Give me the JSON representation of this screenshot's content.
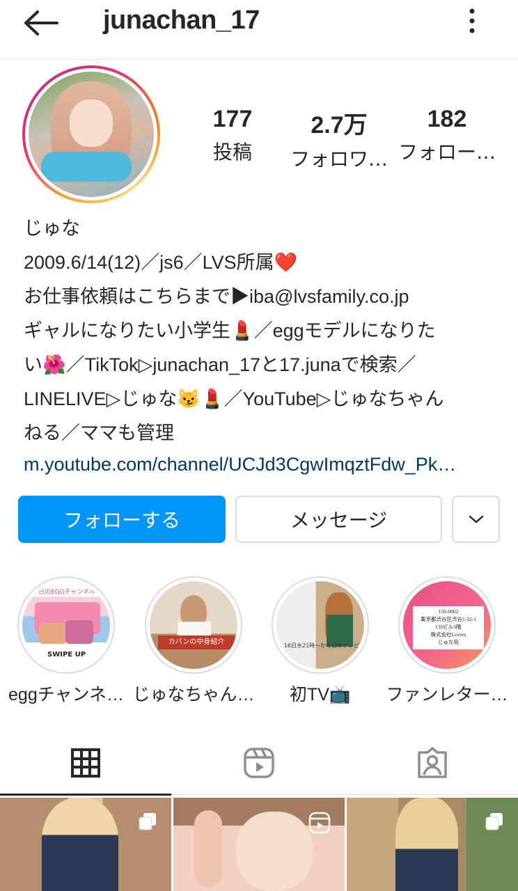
{
  "header": {
    "username": "junachan_17"
  },
  "stats": [
    {
      "value": "177",
      "label": "投稿"
    },
    {
      "value": "2.7万",
      "label": "フォロワ…"
    },
    {
      "value": "182",
      "label": "フォロー…"
    }
  ],
  "bio": {
    "name": "じゅな",
    "lines": [
      "2009.6/14(12)／js6／LVS所属❤️",
      "お仕事依頼はこちらまで▶iba@lvsfamily.co.jp",
      "ギャルになりたい小学生💄／eggモデルになりた",
      "い🌺／TikTok▷junachan_17と17.junaで検索／",
      "LINELIVE▷じゅな😼💄／YouTube▷じゅなちゃん",
      "ねる／ママも管理"
    ],
    "link": "m.youtube.com/channel/UCJd3CgwImqztFdw_Pk…"
  },
  "actions": {
    "follow": "フォローする",
    "message": "メッセージ"
  },
  "highlights": [
    {
      "label": "eggチャンネ…"
    },
    {
      "label": "じゅなちゃん…"
    },
    {
      "label": "初TV📺"
    },
    {
      "label": "ファンレター…"
    }
  ],
  "highlight_texts": {
    "h1_top": "今日のEGGチャンネル",
    "h1_bottom": "SWIPE UP",
    "h2_text": "カバンの中身紹介",
    "h3_text": "16日水21時〜から日本テレビ",
    "h4_addr": [
      "150-0002",
      "東京都渋谷区渋谷1-22-1",
      "CHビル3階",
      "株式会社Lovers",
      "じゅな宛"
    ]
  },
  "colors": {
    "follow_button": "#0095f6",
    "link": "#00376b"
  }
}
